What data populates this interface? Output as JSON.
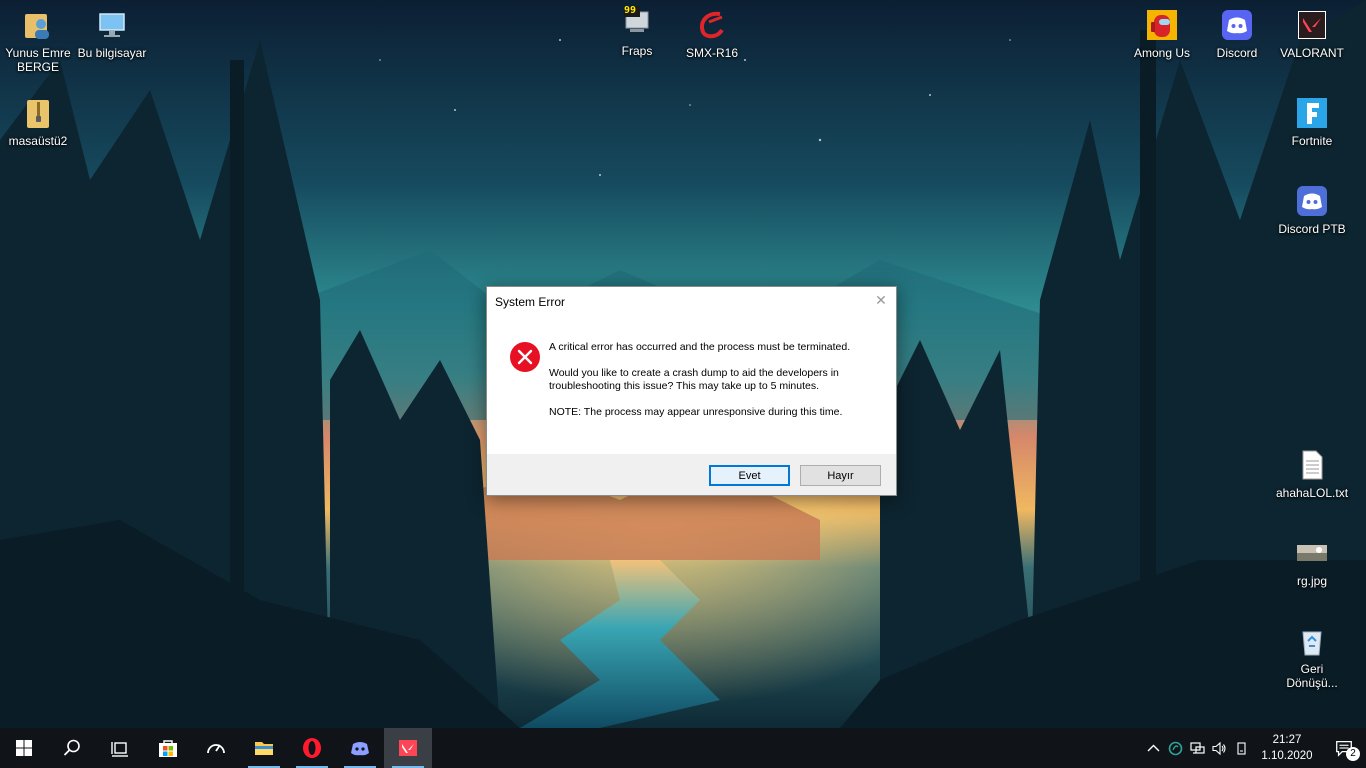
{
  "desktop": {
    "icons": {
      "user_folder": "Yunus Emre BERGE",
      "this_pc": "Bu bilgisayar",
      "masaustu2": "masaüstü2",
      "fraps": "Fraps",
      "fraps_badge": "99",
      "smx": "SMX-R16",
      "among_us": "Among Us",
      "discord": "Discord",
      "valorant": "VALORANT",
      "fortnite": "Fortnite",
      "discord_ptb": "Discord PTB",
      "text_file": "ahahaLOL.txt",
      "image_file": "rg.jpg",
      "recycle_bin": "Geri Dönüşü..."
    }
  },
  "dialog": {
    "title": "System Error",
    "message_1": "A critical error has occurred and the process must be terminated.",
    "message_2": "Would you like to create a crash dump to aid the developers in troubleshooting this issue? This may take up to 5 minutes.",
    "message_3": "NOTE: The process may appear unresponsive during this time.",
    "yes_label": "Evet",
    "no_label": "Hayır"
  },
  "taskbar": {
    "apps": [
      "start-icon",
      "search-icon",
      "task-view-icon",
      "store-icon",
      "speed-meter-icon",
      "file-explorer-icon",
      "opera-icon",
      "discord-icon",
      "valorant-icon"
    ],
    "time": "21:27",
    "date": "1.10.2020",
    "notification_count": "2"
  },
  "colors": {
    "taskbar": "#101418",
    "accent": "#0078d7",
    "error_red": "#e81123",
    "discord": "#5865f2",
    "valorant": "#fd4556"
  }
}
